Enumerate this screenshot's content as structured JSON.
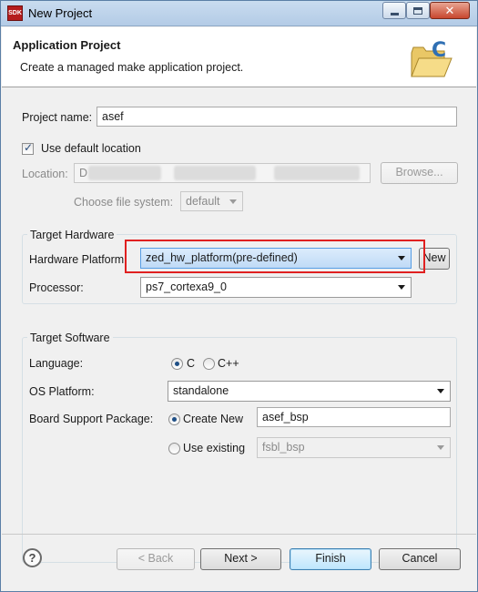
{
  "window": {
    "title": "New Project",
    "app_icon_text": "SDK",
    "close_glyph": "✕"
  },
  "header": {
    "title": "Application Project",
    "description": "Create a managed make application project."
  },
  "project": {
    "name_label": "Project name:",
    "name_value": "asef",
    "use_default_label": "Use default location",
    "use_default_checked": true,
    "location_label": "Location:",
    "location_value": "D",
    "browse_label": "Browse...",
    "filesystem_label": "Choose file system:",
    "filesystem_value": "default"
  },
  "target_hardware": {
    "group_label": "Target Hardware",
    "platform_label": "Hardware Platform:",
    "platform_value": "zed_hw_platform(pre-defined)",
    "new_button": "New",
    "processor_label": "Processor:",
    "processor_value": "ps7_cortexa9_0"
  },
  "target_software": {
    "group_label": "Target Software",
    "language_label": "Language:",
    "language_c": "C",
    "language_cpp": "C++",
    "language_selected": "C",
    "os_label": "OS Platform:",
    "os_value": "standalone",
    "bsp_label": "Board Support Package:",
    "create_new_label": "Create New",
    "create_new_value": "asef_bsp",
    "use_existing_label": "Use existing",
    "use_existing_value": "fsbl_bsp",
    "bsp_selected": "Create New"
  },
  "footer": {
    "help_glyph": "?",
    "back_label": "< Back",
    "next_label": "Next >",
    "finish_label": "Finish",
    "cancel_label": "Cancel"
  },
  "colors": {
    "highlight_box": "#e02020",
    "selection": "#bfdaf6"
  }
}
